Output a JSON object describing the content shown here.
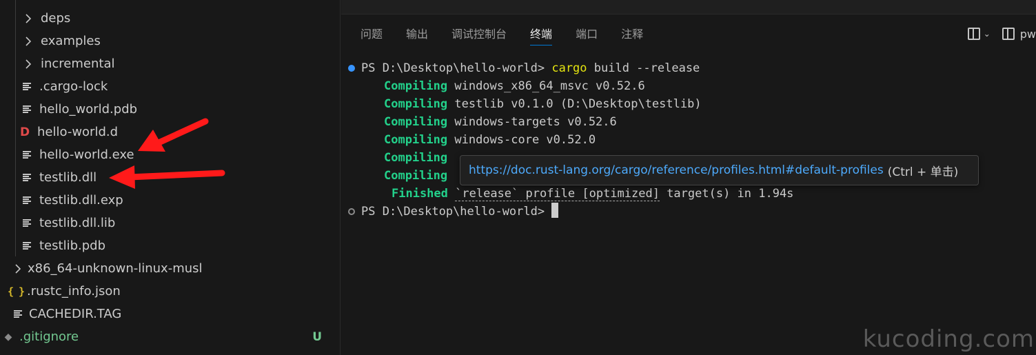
{
  "explorer": {
    "items": [
      {
        "label": "deps",
        "kind": "folder"
      },
      {
        "label": "examples",
        "kind": "folder"
      },
      {
        "label": "incremental",
        "kind": "folder"
      },
      {
        "label": ".cargo-lock",
        "kind": "file"
      },
      {
        "label": "hello_world.pdb",
        "kind": "file"
      },
      {
        "label": "hello-world.d",
        "kind": "d-file",
        "icon_text": "D"
      },
      {
        "label": "hello-world.exe",
        "kind": "file"
      },
      {
        "label": "testlib.dll",
        "kind": "file"
      },
      {
        "label": "testlib.dll.exp",
        "kind": "file"
      },
      {
        "label": "testlib.dll.lib",
        "kind": "file"
      },
      {
        "label": "testlib.pdb",
        "kind": "file"
      },
      {
        "label": "x86_64-unknown-linux-musl",
        "kind": "folder"
      },
      {
        "label": ".rustc_info.json",
        "kind": "json",
        "icon_text": "{ }"
      },
      {
        "label": "CACHEDIR.TAG",
        "kind": "file"
      },
      {
        "label": ".gitignore",
        "kind": "git",
        "badge": "U"
      }
    ]
  },
  "panel": {
    "tabs": [
      "问题",
      "输出",
      "调试控制台",
      "终端",
      "端口",
      "注释"
    ],
    "active_tab": "终端",
    "shell_label": "pw"
  },
  "terminal": {
    "prompt1": "PS D:\\Desktop\\hello-world> ",
    "cmd_keyword": "cargo",
    "cmd_rest": " build --release",
    "compile_lines": [
      {
        "verb": "Compiling",
        "text": " windows_x86_64_msvc v0.52.6"
      },
      {
        "verb": "Compiling",
        "text": " testlib v0.1.0 (D:\\Desktop\\testlib)"
      },
      {
        "verb": "Compiling",
        "text": " windows-targets v0.52.6"
      },
      {
        "verb": "Compiling",
        "text": " windows-core v0.52.0"
      },
      {
        "verb": "Compiling",
        "text": ""
      },
      {
        "verb": "Compiling",
        "text": ""
      }
    ],
    "finished_verb": "Finished",
    "finished_link": "`release` profile [optimized]",
    "finished_rest": " target(s) in 1.94s",
    "prompt2": "PS D:\\Desktop\\hello-world> "
  },
  "hover": {
    "link": "https://doc.rust-lang.org/cargo/reference/profiles.html#default-profiles",
    "hint": "(Ctrl + 单击)"
  },
  "watermark": "kucoding.com",
  "colors": {
    "annotation_arrow": "#ff1a1a",
    "compiling": "#23d18b",
    "link": "#4daafc",
    "tab_underline": "#0078d4"
  }
}
